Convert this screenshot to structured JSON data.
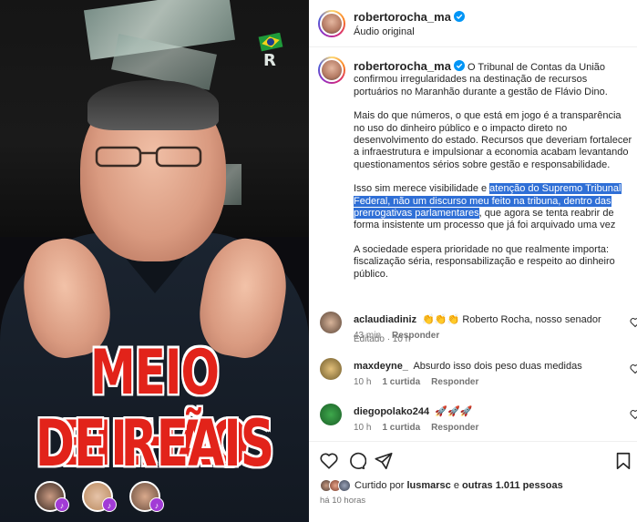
{
  "post": {
    "username": "robertorocha_ma",
    "audio_label": "Áudio original",
    "media_caption_line1": "MEIO BILHÃO",
    "media_caption_line2": "DE REAIS",
    "caption_intro": "O Tribunal de Contas da União confirmou irregularidades na destinação de recursos portuários no Maranhão durante a gestão de Flávio Dino.",
    "caption_p2": "Mais do que números, o que está em jogo é a transparência no uso do dinheiro público e o impacto direto no desenvolvimento do estado. Recursos que deveriam fortalecer a infraestrutura e impulsionar a economia acabam levantando questionamentos sérios sobre gestão e responsabilidade.",
    "caption_p3_before": "Isso sim merece visibilidade e ",
    "caption_p3_highlight": "atenção do Supremo Tribunal Federal, não um discurso meu feito na tribuna, dentro das prerrogativas parlamentares",
    "caption_p3_after": ", que agora se tenta reabrir de forma insistente um processo que já foi arquivado uma vez",
    "caption_p4": "A sociedade espera prioridade no que realmente importa: fiscalização séria, responsabilização e respeito ao dinheiro público.",
    "edited_label": "Editado · 10 h"
  },
  "comments": [
    {
      "user": "aclaudiadiniz",
      "text": "👏👏👏 Roberto Rocha, nosso senador",
      "time": "43 min",
      "likes": "",
      "reply": "Responder"
    },
    {
      "user": "maxdeyne_",
      "text": "Absurdo isso dois peso duas medidas",
      "time": "10 h",
      "likes": "1 curtida",
      "reply": "Responder"
    },
    {
      "user": "diegopolako244",
      "text": "🚀🚀🚀",
      "time": "10 h",
      "likes": "1 curtida",
      "reply": "Responder"
    }
  ],
  "likes": {
    "prefix": "Curtido por ",
    "user": "lusmarsc",
    "middle": " e ",
    "others": "outras 1.011 pessoas"
  },
  "timestamp": "há 10 horas",
  "icons": {
    "like": "heart-icon",
    "comment": "comment-icon",
    "share": "paper-plane-icon",
    "save": "bookmark-icon",
    "verified": "verified-badge-icon"
  },
  "colors": {
    "highlight": "#2f6fd6",
    "caption_red": "#e2231a",
    "verified_blue": "#0095f6"
  }
}
